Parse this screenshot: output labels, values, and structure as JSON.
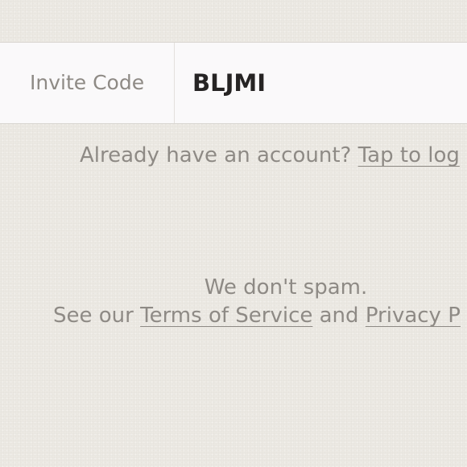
{
  "invite": {
    "label": "Invite Code",
    "value": "BLJMI"
  },
  "login": {
    "prompt": "Already have an account?",
    "link": "Tap to log"
  },
  "footer": {
    "spam_text": "We don't spam.",
    "see_our": "See our",
    "terms_link": "Terms of Service",
    "and": "and",
    "privacy_link": "Privacy P"
  }
}
